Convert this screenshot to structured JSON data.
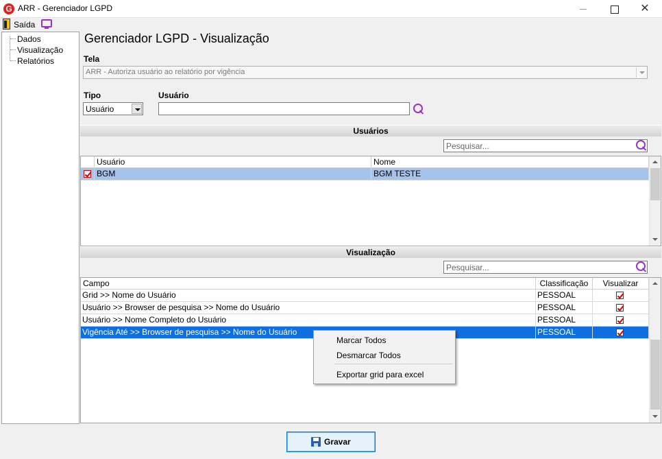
{
  "window": {
    "title": "ARR - Gerenciador LGPD"
  },
  "toolbar": {
    "exit_label": "Saída"
  },
  "tree": {
    "items": [
      {
        "label": "Dados"
      },
      {
        "label": "Visualização"
      },
      {
        "label": "Relatórios"
      }
    ]
  },
  "page": {
    "title": "Gerenciador LGPD - Visualização"
  },
  "tela": {
    "label": "Tela",
    "value": "ARR - Autoriza usuário ao relatório por vigência"
  },
  "tipo": {
    "label": "Tipo",
    "value": "Usuário"
  },
  "usuario": {
    "label": "Usuário",
    "value": ""
  },
  "usuarios_section": {
    "title": "Usuários",
    "search_placeholder": "Pesquisar...",
    "columns": [
      "Usuário",
      "Nome"
    ],
    "rows": [
      {
        "checked": true,
        "usuario": "BGM",
        "nome": "BGM TESTE"
      }
    ]
  },
  "visualizacao_section": {
    "title": "Visualização",
    "search_placeholder": "Pesquisar...",
    "columns": [
      "Campo",
      "Classificação",
      "Visualizar"
    ],
    "rows": [
      {
        "campo": "Grid >> Nome do Usuário",
        "classificacao": "PESSOAL",
        "visualizar": true
      },
      {
        "campo": "Usuário >> Browser de pesquisa >> Nome do Usuário",
        "classificacao": "PESSOAL",
        "visualizar": true
      },
      {
        "campo": "Usuário >> Nome Completo do Usuário",
        "classificacao": "PESSOAL",
        "visualizar": true
      },
      {
        "campo": "Vigência Até >> Browser de pesquisa >> Nome do Usuário",
        "classificacao": "PESSOAL",
        "visualizar": true
      }
    ]
  },
  "context_menu": {
    "items": [
      "Marcar Todos",
      "Desmarcar Todos",
      "Exportar grid para excel"
    ]
  },
  "footer": {
    "save_label": "Gravar"
  },
  "colors": {
    "selection": "#0f6fe0",
    "accent_icon": "#9b30c8",
    "check": "#cc0000"
  }
}
